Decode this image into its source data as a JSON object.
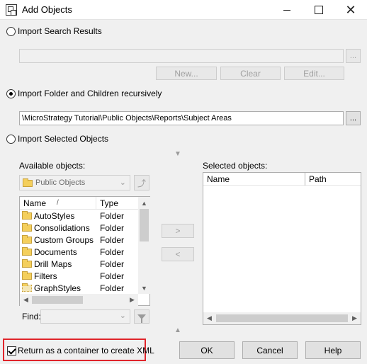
{
  "window": {
    "title": "Add Objects",
    "minimize": "—",
    "maximize": "☐",
    "close": "✕"
  },
  "import_search": {
    "label": "Import Search Results",
    "selected": false,
    "value": "",
    "browse_label": "...",
    "new_label": "New...",
    "clear_label": "Clear",
    "edit_label": "Edit..."
  },
  "import_folder": {
    "label": "Import Folder and Children recursively",
    "selected": true,
    "value": "\\MicroStrategy Tutorial\\Public Objects\\Reports\\Subject Areas",
    "browse_label": "..."
  },
  "import_selected": {
    "label": "Import Selected Objects",
    "selected": false
  },
  "available": {
    "label": "Available objects:",
    "folder_value": "Public Objects",
    "columns": [
      "Name",
      "Type"
    ],
    "sort_indicator": "/",
    "rows": [
      {
        "name": "AutoStyles",
        "type": "Folder",
        "icon": "folder-icon"
      },
      {
        "name": "Consolidations",
        "type": "Folder",
        "icon": "folder-icon"
      },
      {
        "name": "Custom Groups",
        "type": "Folder",
        "icon": "folder-icon"
      },
      {
        "name": "Documents",
        "type": "Folder",
        "icon": "folder-icon"
      },
      {
        "name": "Drill Maps",
        "type": "Folder",
        "icon": "folder-icon"
      },
      {
        "name": "Filters",
        "type": "Folder",
        "icon": "folder-icon"
      },
      {
        "name": "GraphStyles",
        "type": "Folder",
        "icon": "folder-dotted-icon"
      }
    ],
    "find_label": "Find:",
    "find_value": ""
  },
  "transfer": {
    "add_label": ">",
    "remove_label": "<"
  },
  "selected_objects": {
    "label": "Selected objects:",
    "columns": [
      "Name",
      "Path"
    ],
    "rows": []
  },
  "footer": {
    "container_label": "Return as a container to create XML",
    "container_checked": true,
    "ok_label": "OK",
    "cancel_label": "Cancel",
    "help_label": "Help"
  },
  "colors": {
    "highlight_border": "#e0252b",
    "folder": "#f4cf5c"
  }
}
